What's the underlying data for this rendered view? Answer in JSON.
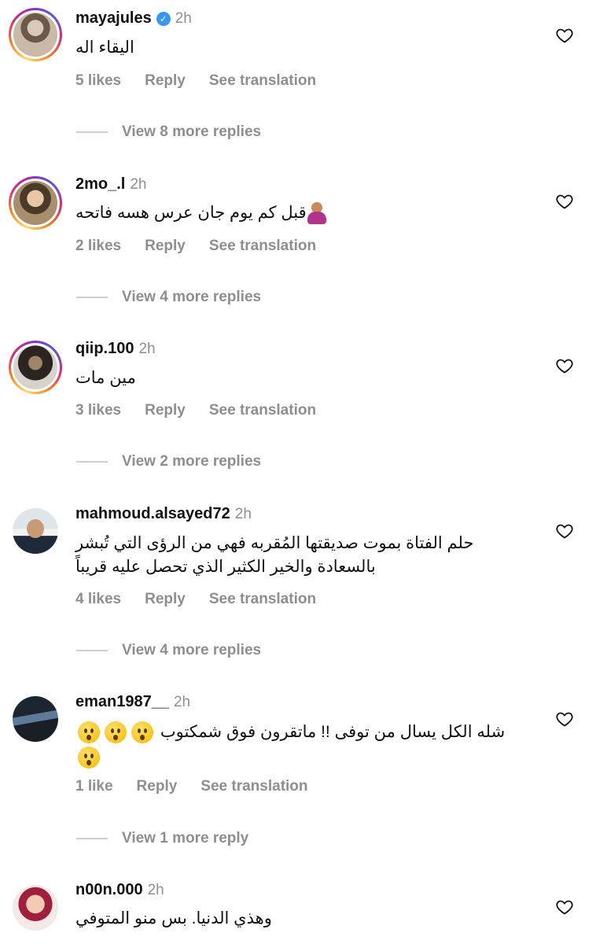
{
  "comments": [
    {
      "username": "mayajules",
      "verified": true,
      "time": "2h",
      "text": "اليقاء اله",
      "likes": "5 likes",
      "reply": "Reply",
      "translate": "See translation",
      "view_more": "View 8 more replies"
    },
    {
      "username": "2mo_.l",
      "verified": false,
      "time": "2h",
      "text": "قبل كم يوم جان عرس هسه فاتحه",
      "likes": "2 likes",
      "reply": "Reply",
      "translate": "See translation",
      "view_more": "View 4 more replies"
    },
    {
      "username": "qiip.100",
      "verified": false,
      "time": "2h",
      "text": "مين مات",
      "likes": "3 likes",
      "reply": "Reply",
      "translate": "See translation",
      "view_more": "View 2 more replies"
    },
    {
      "username": "mahmoud.alsayed72",
      "verified": false,
      "time": "2h",
      "text_line1": "حلم الفتاة بموت صديقتها المُقربه فهي من الرؤى التي تُبشر",
      "text_line2": "بالسعادة والخير الكثير الذي تحصل عليه قريباً",
      "likes": "4 likes",
      "reply": "Reply",
      "translate": "See translation",
      "view_more": "View 4 more replies"
    },
    {
      "username": "eman1987__",
      "verified": false,
      "time": "2h",
      "text": "شله الكل يسال من توفى !! ماتقرون فوق شمكتوب",
      "likes": "1 like",
      "reply": "Reply",
      "translate": "See translation",
      "view_more": "View 1 more reply"
    },
    {
      "username": "n00n.000",
      "verified": false,
      "time": "2h",
      "text": "وهذي الدنيا. بس منو المتوفي"
    }
  ],
  "icons": {
    "heart": "heart-outline-icon",
    "verified": "verified-badge-icon",
    "emoji_face": "hushed-face-emoji",
    "emoji_person": "person-gesturing-emoji"
  },
  "colors": {
    "muted": "#8e8e8e",
    "verified": "#3897f0",
    "text": "#111111"
  }
}
